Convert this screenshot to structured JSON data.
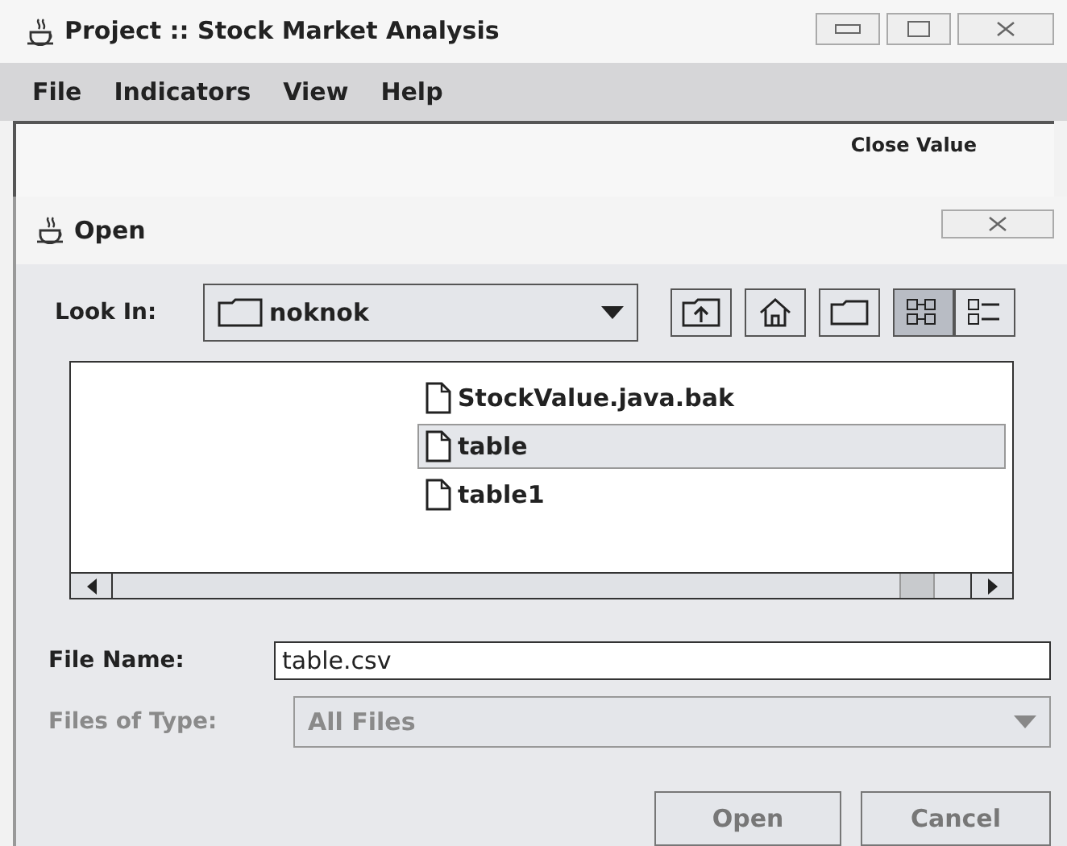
{
  "window": {
    "title": "Project :: Stock Market Analysis"
  },
  "menu": [
    "File",
    "Indicators",
    "View",
    "Help"
  ],
  "content": {
    "header": "Close Value"
  },
  "dialog": {
    "title": "Open",
    "look_in": {
      "label": "Look In:",
      "value": "noknok"
    },
    "view_modes": [
      {
        "kind": "list",
        "selected": true
      },
      {
        "kind": "details",
        "selected": false
      }
    ],
    "files": [
      {
        "name": "StockValue.java.bak",
        "selected": false
      },
      {
        "name": "table",
        "selected": true
      },
      {
        "name": "table1",
        "selected": false
      }
    ],
    "file_name": {
      "label": "File Name:",
      "value": "table.csv"
    },
    "files_of_type": {
      "label": "Files of Type:",
      "value": "All Files",
      "disabled": true
    },
    "buttons": [
      "Open",
      "Cancel"
    ]
  }
}
